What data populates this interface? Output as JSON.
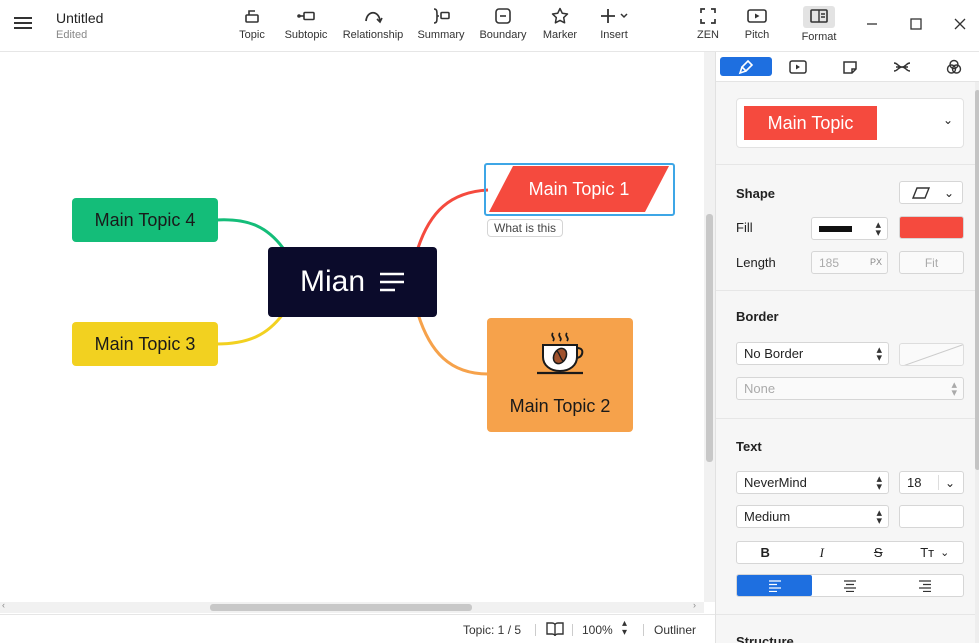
{
  "doc": {
    "title": "Untitled",
    "status": "Edited"
  },
  "toolbar": {
    "topic": "Topic",
    "subtopic": "Subtopic",
    "relationship": "Relationship",
    "summary": "Summary",
    "boundary": "Boundary",
    "marker": "Marker",
    "insert": "Insert",
    "zen": "ZEN",
    "pitch": "Pitch",
    "format": "Format"
  },
  "map": {
    "central": "Mian",
    "topic1": "Main Topic 1",
    "topic1_label": "What is this",
    "topic2": "Main Topic 2",
    "topic3": "Main Topic 3",
    "topic4": "Main Topic 4"
  },
  "colors": {
    "central": "#0b0b2b",
    "topic1": "#f54a3e",
    "topic2": "#f6a24b",
    "topic3": "#f2d120",
    "topic4": "#14bd79",
    "accent": "#1e6fe0",
    "selection": "#3ea6e6"
  },
  "statusbar": {
    "topic_count": "Topic: 1 / 5",
    "zoom": "100%",
    "outliner": "Outliner"
  },
  "panel": {
    "style_name": "Main Topic",
    "shape_header": "Shape",
    "fill_label": "Fill",
    "length_label": "Length",
    "length_value": "185",
    "length_unit": "PX",
    "fit_button": "Fit",
    "border_header": "Border",
    "border_value": "No Border",
    "border_style": "None",
    "text_header": "Text",
    "font_family": "NeverMind",
    "font_size": "18",
    "font_weight": "Medium",
    "bold": "B",
    "italic": "I",
    "strike": "S",
    "case": "Tт",
    "structure_header": "Structure"
  }
}
